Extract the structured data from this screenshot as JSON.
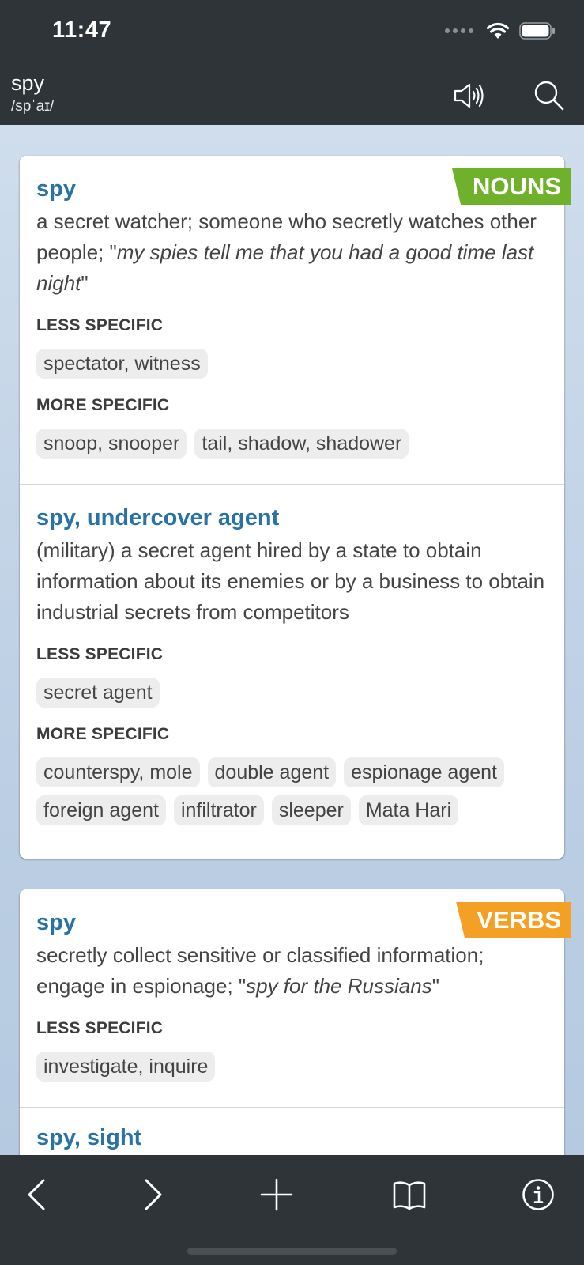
{
  "status_bar": {
    "time": "11:47"
  },
  "header": {
    "word": "spy",
    "pronunciation": "/spˈaɪ/"
  },
  "nouns": {
    "tag": "NOUNS",
    "senses": [
      {
        "lemma": "spy",
        "gloss": "a secret watcher; someone who secretly watches other people; \"",
        "example": "my spies tell me that you had a good time last night",
        "gloss_end": "\"",
        "less_specific_title": "LESS SPECIFIC",
        "less_specific": [
          "spectator, witness"
        ],
        "more_specific_title": "MORE SPECIFIC",
        "more_specific": [
          "snoop, snooper",
          "tail, shadow, shadower"
        ]
      },
      {
        "lemma": "spy, undercover agent",
        "gloss": "(military) a secret agent hired by a state to obtain information about its enemies or by a business to obtain industrial secrets from competitors",
        "less_specific_title": "LESS SPECIFIC",
        "less_specific": [
          "secret agent"
        ],
        "more_specific_title": "MORE SPECIFIC",
        "more_specific": [
          "counterspy, mole",
          "double agent",
          "espionage agent",
          "foreign agent",
          "infiltrator",
          "sleeper",
          "Mata Hari"
        ]
      }
    ]
  },
  "verbs": {
    "tag": "VERBS",
    "senses": [
      {
        "lemma": "spy",
        "gloss": "secretly collect sensitive or classified information; engage in espionage; \"",
        "example": "spy for the Russians",
        "gloss_end": "\"",
        "less_specific_title": "LESS SPECIFIC",
        "less_specific": [
          "investigate, inquire"
        ]
      },
      {
        "lemma": "spy, sight"
      }
    ]
  },
  "tab_bar": {
    "icons": [
      "back-icon",
      "forward-icon",
      "plus-icon",
      "book-icon",
      "info-icon"
    ]
  }
}
